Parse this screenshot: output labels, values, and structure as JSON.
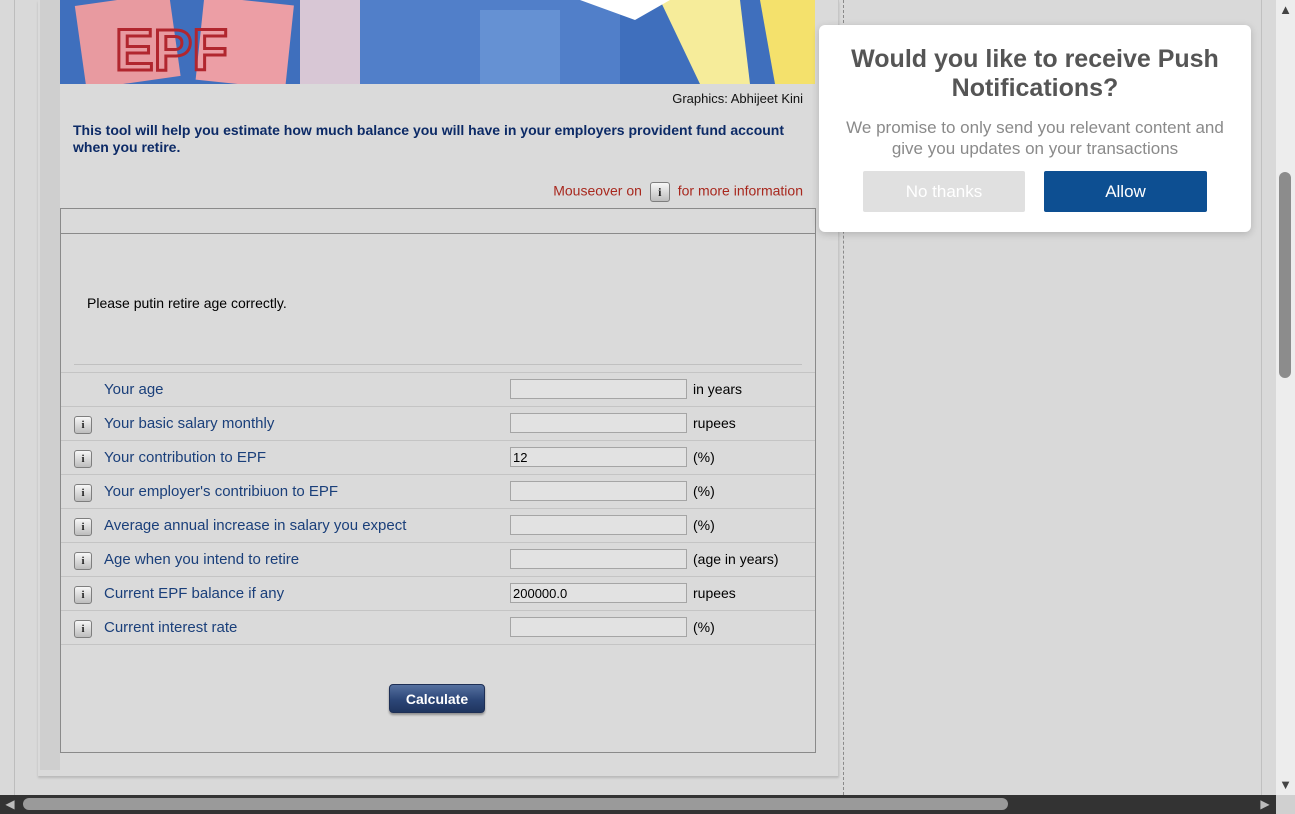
{
  "banner": {
    "graphic_text": "EPF"
  },
  "credit": "Graphics: Abhijeet Kini",
  "intro": "This tool will help you estimate how much balance you will have in your employers provident fund account when you retire.",
  "mouseover": {
    "before": "Mouseover on",
    "after": "for more information",
    "icon_glyph": "i"
  },
  "form": {
    "error": "Please putin retire age correctly.",
    "rows": [
      {
        "label": "Your age",
        "value": "",
        "unit": "in years",
        "has_info": false
      },
      {
        "label": "Your basic salary monthly",
        "value": "",
        "unit": "rupees",
        "has_info": true
      },
      {
        "label": "Your contribution to EPF",
        "value": "12",
        "unit": "(%)",
        "has_info": true
      },
      {
        "label": "Your employer's contribiuon to EPF",
        "value": "",
        "unit": "(%)",
        "has_info": true
      },
      {
        "label": "Average annual increase in salary you expect",
        "value": "",
        "unit": "(%)",
        "has_info": true
      },
      {
        "label": "Age when you intend to retire",
        "value": "",
        "unit": "(age in years)",
        "has_info": true
      },
      {
        "label": "Current EPF balance if any",
        "value": "200000.0",
        "unit": "rupees",
        "has_info": true
      },
      {
        "label": "Current interest rate",
        "value": "",
        "unit": "(%)",
        "has_info": true
      }
    ],
    "calculate_label": "Calculate"
  },
  "popup": {
    "title": "Would you like to receive Push Notifications?",
    "body": "We promise to only send you relevant content and give you updates on your transactions",
    "no_label": "No thanks",
    "allow_label": "Allow"
  },
  "scrollbars": {
    "up": "▲",
    "down": "▼",
    "left": "◀",
    "right": "▶"
  },
  "colors": {
    "accent": "#0d4f92",
    "label_blue": "#1a3f7a",
    "intro_blue": "#0c2a66",
    "hint_red": "#a8281e"
  }
}
